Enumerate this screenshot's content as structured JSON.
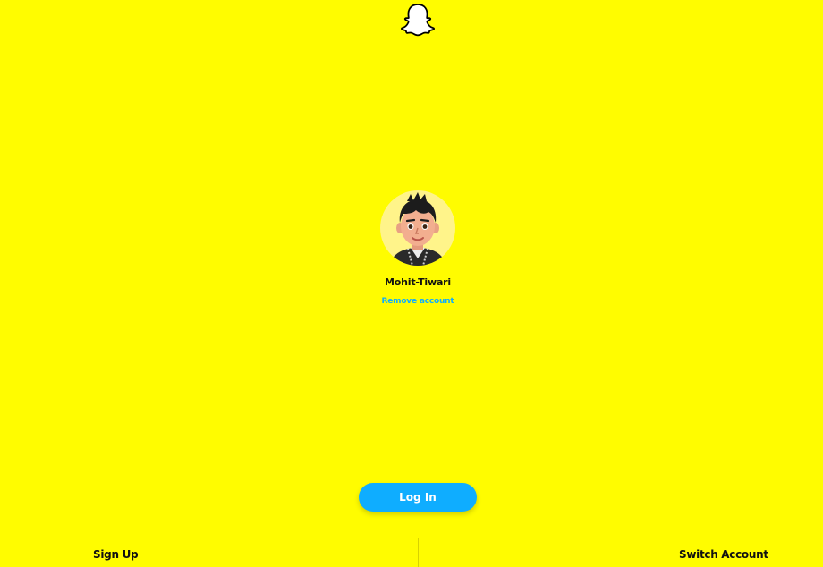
{
  "app": {
    "logo_icon": "snapchat-ghost-icon",
    "brand_color": "#FFFC00",
    "accent_color": "#0FADFF"
  },
  "account": {
    "avatar_icon": "bitmoji-avatar",
    "username": "Mohit-Tiwari",
    "remove_label": "Remove account"
  },
  "actions": {
    "login_label": "Log In"
  },
  "footer": {
    "signup_label": "Sign Up",
    "switch_label": "Switch Account"
  }
}
